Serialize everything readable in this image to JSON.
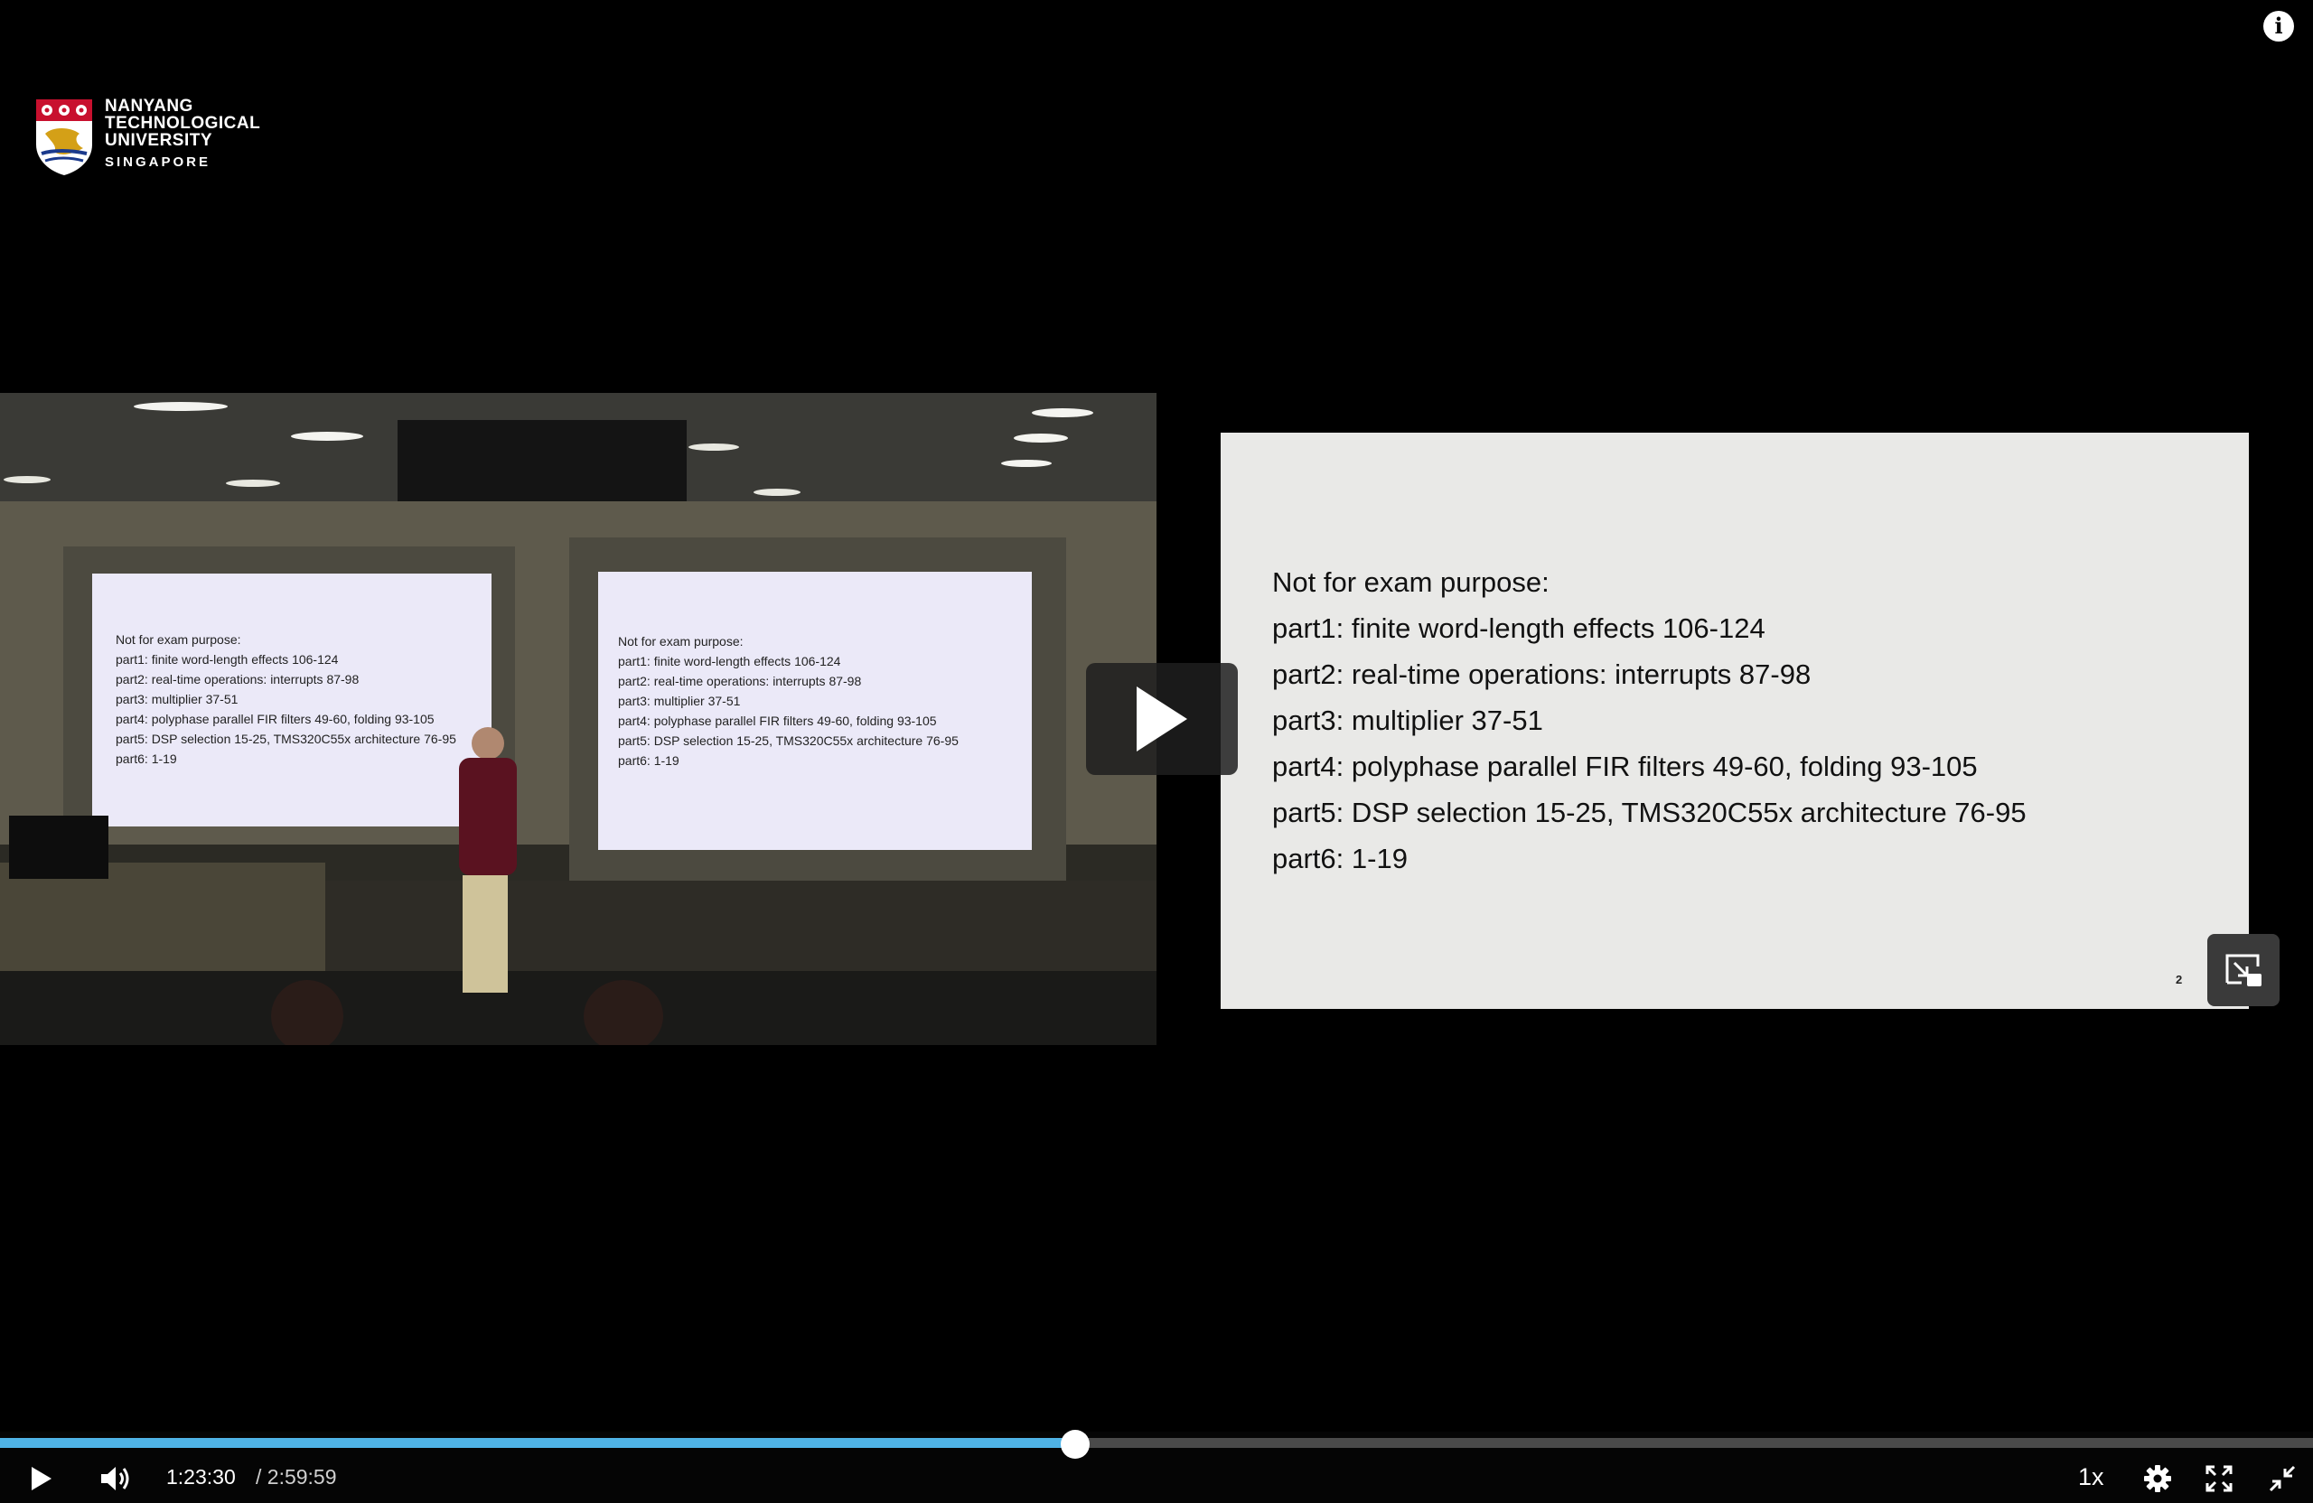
{
  "header": {
    "info_icon": "info-icon",
    "info_glyph": "i"
  },
  "logo": {
    "line1": "NANYANG",
    "line2": "TECHNOLOGICAL",
    "line3": "UNIVERSITY",
    "line4": "SINGAPORE"
  },
  "camera_view": {
    "left_screen": [
      "Not for exam purpose:",
      "part1: finite word-length effects 106-124",
      "part2: real-time operations: interrupts 87-98",
      "part3: multiplier 37-51",
      "part4: polyphase parallel FIR filters 49-60, folding 93-105",
      "part5: DSP selection 15-25, TMS320C55x architecture 76-95",
      "part6: 1-19"
    ],
    "right_screen": [
      "Not for exam purpose:",
      "part1: finite word-length effects 106-124",
      "part2: real-time operations: interrupts 87-98",
      "part3: multiplier 37-51",
      "part4: polyphase parallel FIR filters 49-60, folding 93-105",
      "part5: DSP selection 15-25, TMS320C55x architecture 76-95",
      "part6: 1-19"
    ]
  },
  "slide": {
    "lines": [
      "Not for exam purpose:",
      "part1: finite word-length effects 106-124",
      "part2: real-time operations: interrupts 87-98",
      "part3: multiplier 37-51",
      "part4: polyphase parallel FIR filters 49-60, folding 93-105",
      "part5: DSP selection 15-25, TMS320C55x architecture 76-95",
      "part6: 1-19"
    ],
    "page_number": "2"
  },
  "player": {
    "current_time": "1:23:30",
    "duration": "/ 2:59:59",
    "progress": 0.4648,
    "speed": "1x",
    "accent_color": "#4fb3e6",
    "icons": [
      "play-icon",
      "volume-icon",
      "gear-icon",
      "fullscreen-icon",
      "exit-fullscreen-icon",
      "pip-swap-icon"
    ]
  }
}
